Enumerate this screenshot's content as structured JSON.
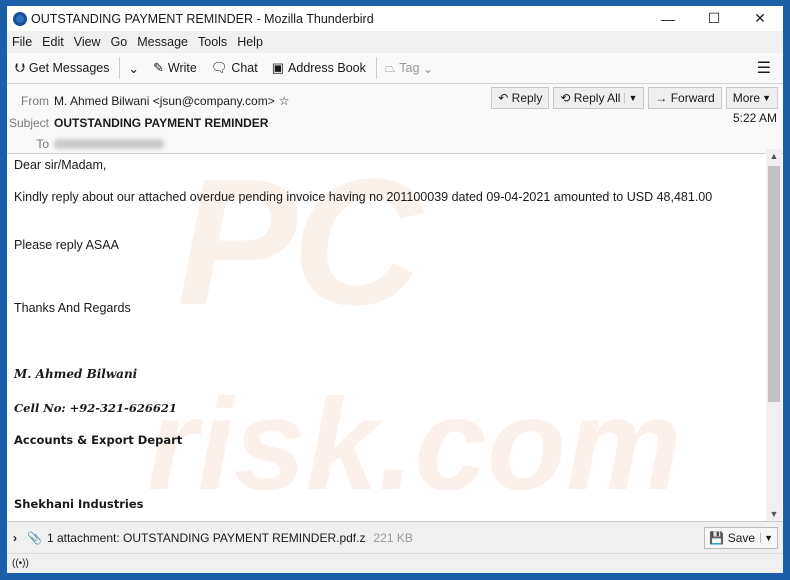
{
  "window": {
    "title": "OUTSTANDING PAYMENT REMINDER - Mozilla Thunderbird",
    "minimize": "—",
    "maximize": "☐",
    "close": "✕"
  },
  "menu": [
    "File",
    "Edit",
    "View",
    "Go",
    "Message",
    "Tools",
    "Help"
  ],
  "toolbar": {
    "get_messages": "Get Messages",
    "write": "Write",
    "chat": "Chat",
    "address_book": "Address Book",
    "tag": "Tag"
  },
  "header": {
    "from_label": "From",
    "from": "M. Ahmed Bilwani <jsun@company.com>",
    "subject_label": "Subject",
    "subject": "OUTSTANDING PAYMENT REMINDER",
    "to_label": "To",
    "time": "5:22 AM",
    "buttons": {
      "reply": "Reply",
      "reply_all": "Reply All",
      "forward": "Forward",
      "more": "More"
    }
  },
  "body": {
    "greeting": "Dear sir/Madam,",
    "line1": "Kindly reply about our attached overdue pending invoice having no 201100039 dated 09-04-2021 amounted to USD 48,481.00",
    "line2": "Please reply ASAA",
    "closing": "Thanks And Regards",
    "sig_name": "M. Ahmed Bilwani",
    "sig_cell": "Cell No: +92-321-626621",
    "sig_dept": "Accounts & Export Depart",
    "sig_company": "Shekhani Industries"
  },
  "watermark": {
    "text1": "PC",
    "text2": "risk.com"
  },
  "attachment": {
    "label": "1 attachment: OUTSTANDING PAYMENT REMINDER.pdf.z",
    "size": "221 KB",
    "save": "Save"
  }
}
